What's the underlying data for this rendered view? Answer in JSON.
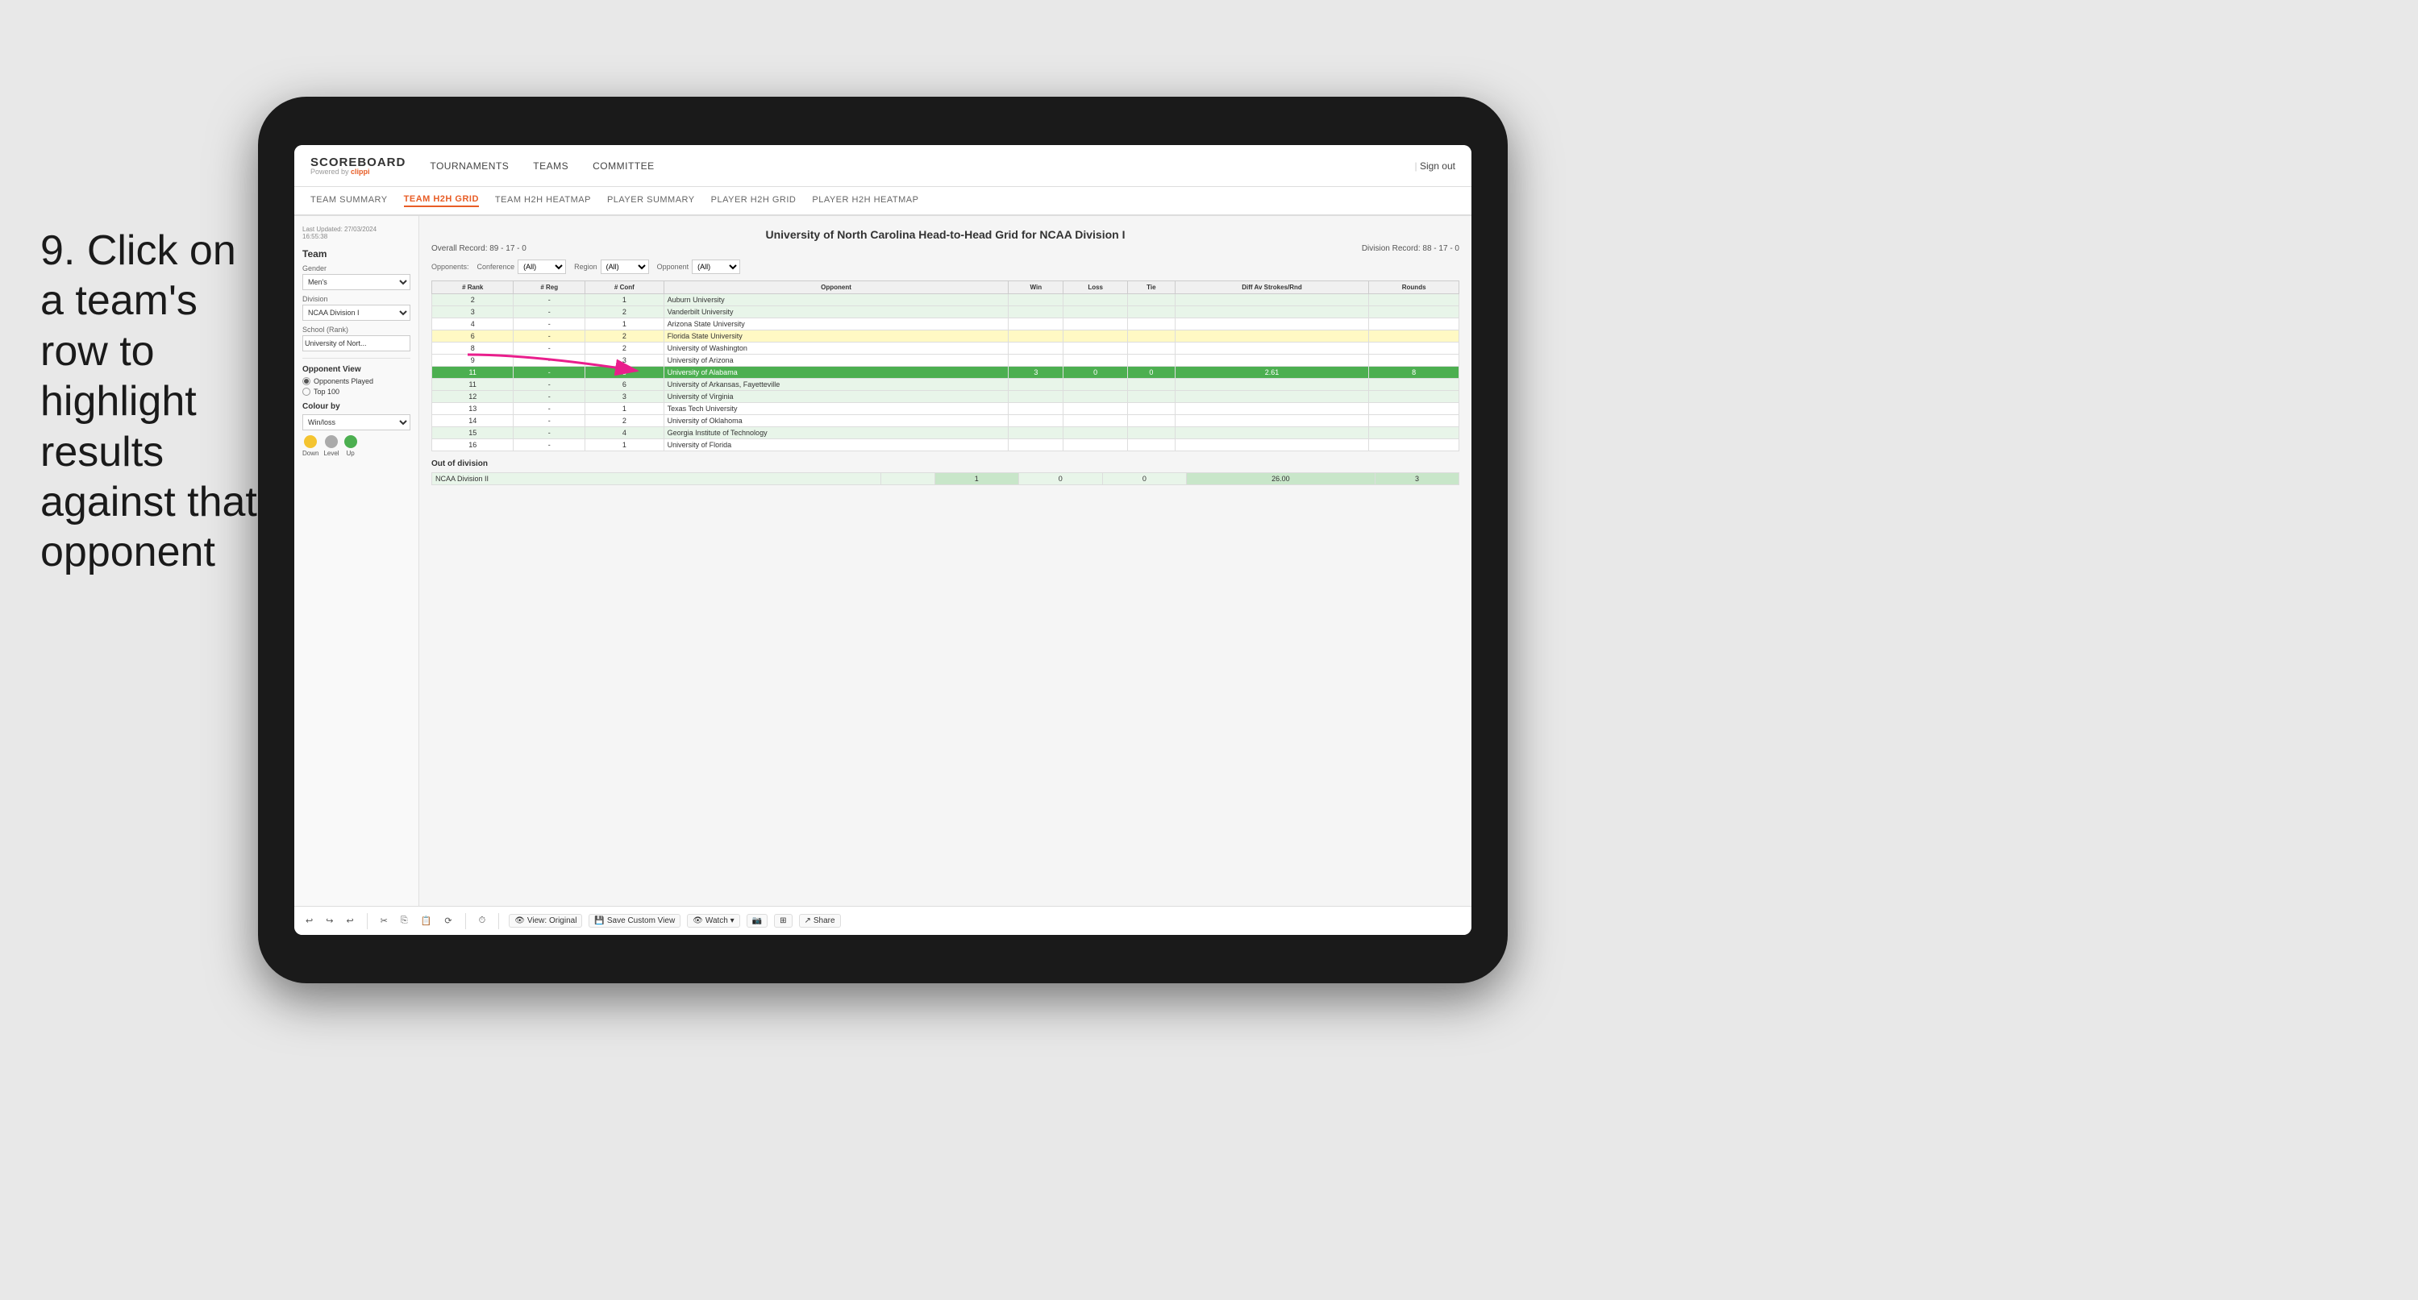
{
  "instruction": {
    "step": "9.",
    "text": "Click on a team's row to highlight results against that opponent"
  },
  "app": {
    "logo": "SCOREBOARD",
    "powered_by": "Powered by clippi",
    "nav_items": [
      "TOURNAMENTS",
      "TEAMS",
      "COMMITTEE"
    ],
    "sign_out": "Sign out"
  },
  "sub_nav": {
    "items": [
      {
        "label": "TEAM SUMMARY",
        "active": false
      },
      {
        "label": "TEAM H2H GRID",
        "active": true
      },
      {
        "label": "TEAM H2H HEATMAP",
        "active": false
      },
      {
        "label": "PLAYER SUMMARY",
        "active": false
      },
      {
        "label": "PLAYER H2H GRID",
        "active": false
      },
      {
        "label": "PLAYER H2H HEATMAP",
        "active": false
      }
    ]
  },
  "sidebar": {
    "last_updated": "Last Updated: 27/03/2024",
    "last_updated_time": "16:55:38",
    "team_label": "Team",
    "gender_label": "Gender",
    "gender_value": "Men's",
    "division_label": "Division",
    "division_value": "NCAA Division I",
    "school_label": "School (Rank)",
    "school_value": "University of Nort...",
    "opponent_view_title": "Opponent View",
    "radio_options": [
      {
        "label": "Opponents Played",
        "selected": true
      },
      {
        "label": "Top 100",
        "selected": false
      }
    ],
    "colour_by_title": "Colour by",
    "colour_by_value": "Win/loss",
    "legend": [
      {
        "color": "#f4c430",
        "label": "Down"
      },
      {
        "color": "#aaa",
        "label": "Level"
      },
      {
        "color": "#4caf50",
        "label": "Up"
      }
    ]
  },
  "report": {
    "title": "University of North Carolina Head-to-Head Grid for NCAA Division I",
    "overall_record_label": "Overall Record:",
    "overall_record": "89 - 17 - 0",
    "division_record_label": "Division Record:",
    "division_record": "88 - 17 - 0",
    "conference_label": "Conference",
    "conference_value": "(All)",
    "region_label": "Region",
    "region_value": "(All)",
    "opponent_label": "Opponent",
    "opponent_value": "(All)",
    "opponents_label": "Opponents:",
    "columns": {
      "rank": "# Rank",
      "reg": "# Reg",
      "conf": "# Conf",
      "opponent": "Opponent",
      "win": "Win",
      "loss": "Loss",
      "tie": "Tie",
      "diff_av": "Diff Av Strokes/Rnd",
      "rounds": "Rounds"
    },
    "rows": [
      {
        "rank": "2",
        "reg": "-",
        "conf": "1",
        "opponent": "Auburn University",
        "win": "",
        "loss": "",
        "tie": "",
        "diff": "",
        "rounds": "",
        "highlight": "light-green"
      },
      {
        "rank": "3",
        "reg": "-",
        "conf": "2",
        "opponent": "Vanderbilt University",
        "win": "",
        "loss": "",
        "tie": "",
        "diff": "",
        "rounds": "",
        "highlight": "light-green"
      },
      {
        "rank": "4",
        "reg": "-",
        "conf": "1",
        "opponent": "Arizona State University",
        "win": "",
        "loss": "",
        "tie": "",
        "diff": "",
        "rounds": "",
        "highlight": "none"
      },
      {
        "rank": "6",
        "reg": "-",
        "conf": "2",
        "opponent": "Florida State University",
        "win": "",
        "loss": "",
        "tie": "",
        "diff": "",
        "rounds": "",
        "highlight": "light-yellow"
      },
      {
        "rank": "8",
        "reg": "-",
        "conf": "2",
        "opponent": "University of Washington",
        "win": "",
        "loss": "",
        "tie": "",
        "diff": "",
        "rounds": "",
        "highlight": "none"
      },
      {
        "rank": "9",
        "reg": "-",
        "conf": "3",
        "opponent": "University of Arizona",
        "win": "",
        "loss": "",
        "tie": "",
        "diff": "",
        "rounds": "",
        "highlight": "none"
      },
      {
        "rank": "11",
        "reg": "-",
        "conf": "5",
        "opponent": "University of Alabama",
        "win": "3",
        "loss": "0",
        "tie": "0",
        "diff": "2.61",
        "rounds": "8",
        "highlight": "selected"
      },
      {
        "rank": "11",
        "reg": "-",
        "conf": "6",
        "opponent": "University of Arkansas, Fayetteville",
        "win": "",
        "loss": "",
        "tie": "",
        "diff": "",
        "rounds": "",
        "highlight": "light-green"
      },
      {
        "rank": "12",
        "reg": "-",
        "conf": "3",
        "opponent": "University of Virginia",
        "win": "",
        "loss": "",
        "tie": "",
        "diff": "",
        "rounds": "",
        "highlight": "light-green"
      },
      {
        "rank": "13",
        "reg": "-",
        "conf": "1",
        "opponent": "Texas Tech University",
        "win": "",
        "loss": "",
        "tie": "",
        "diff": "",
        "rounds": "",
        "highlight": "none"
      },
      {
        "rank": "14",
        "reg": "-",
        "conf": "2",
        "opponent": "University of Oklahoma",
        "win": "",
        "loss": "",
        "tie": "",
        "diff": "",
        "rounds": "",
        "highlight": "none"
      },
      {
        "rank": "15",
        "reg": "-",
        "conf": "4",
        "opponent": "Georgia Institute of Technology",
        "win": "",
        "loss": "",
        "tie": "",
        "diff": "",
        "rounds": "",
        "highlight": "light-green"
      },
      {
        "rank": "16",
        "reg": "-",
        "conf": "1",
        "opponent": "University of Florida",
        "win": "",
        "loss": "",
        "tie": "",
        "diff": "",
        "rounds": "",
        "highlight": "none"
      }
    ],
    "out_of_division_label": "Out of division",
    "out_of_division_row": {
      "division": "NCAA Division II",
      "win": "1",
      "loss": "0",
      "tie": "0",
      "diff": "26.00",
      "rounds": "3"
    }
  },
  "toolbar": {
    "undo": "↩",
    "redo": "↪",
    "undo2": "↩",
    "cut": "✂",
    "copy": "⎘",
    "paste": "📋",
    "refresh": "⟳",
    "view_original": "View: Original",
    "save_custom": "Save Custom View",
    "watch": "Watch ▾",
    "share": "Share"
  }
}
